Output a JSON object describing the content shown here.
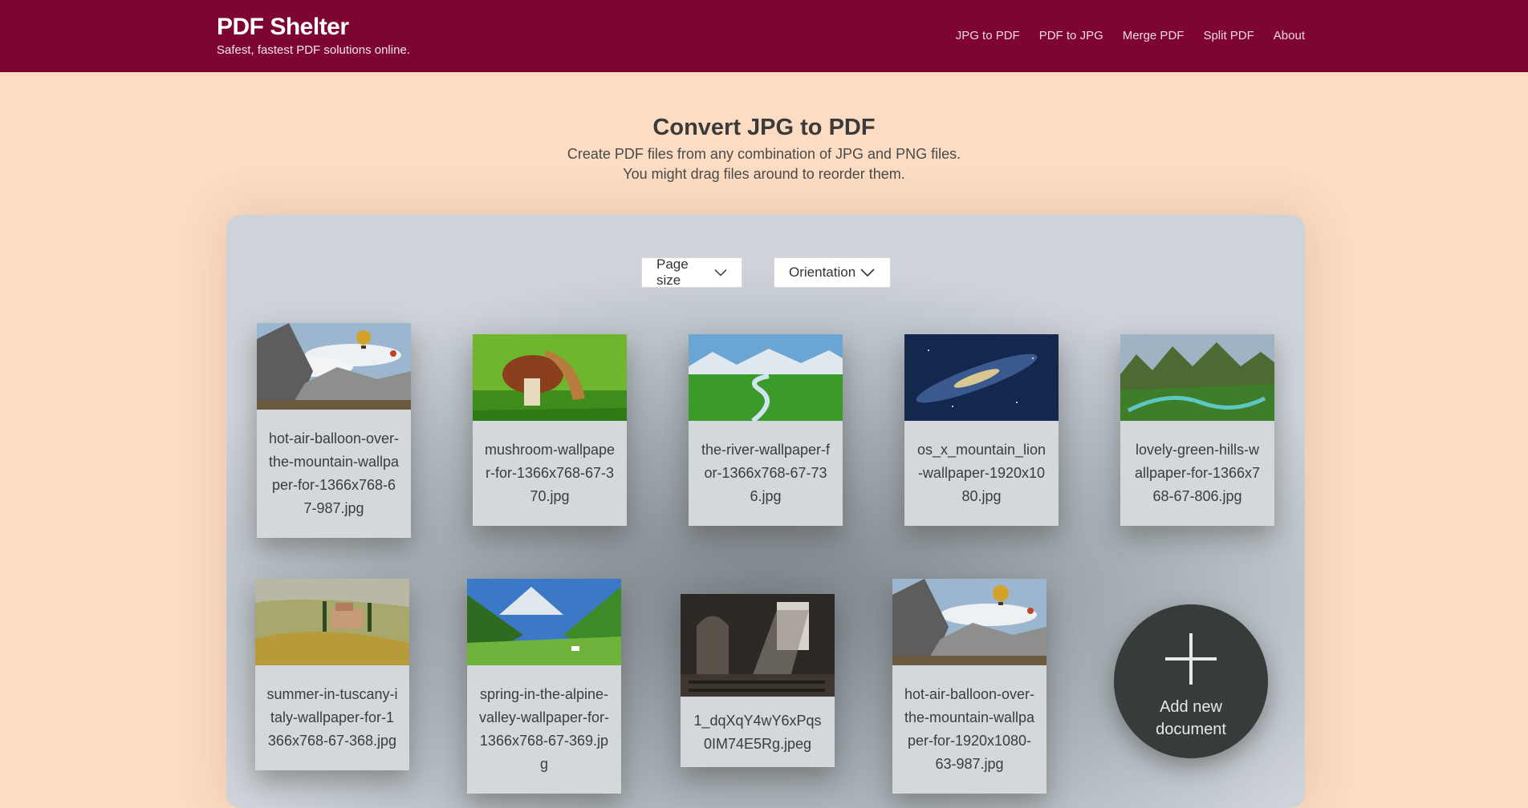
{
  "header": {
    "title": "PDF Shelter",
    "tagline": "Safest, fastest PDF solutions online.",
    "bg_color": "#7e0532",
    "nav": [
      "JPG to PDF",
      "PDF to JPG",
      "Merge PDF",
      "Split PDF",
      "About"
    ]
  },
  "intro": {
    "title": "Convert JPG to PDF",
    "line1": "Create PDF files from any combination of JPG and PNG files.",
    "line2": "You might drag files around to reorder them."
  },
  "controls": {
    "page_size_label": "Page size",
    "orientation_label": "Orientation"
  },
  "files": [
    {
      "name": "hot-air-balloon-over-the-mountain-wallpaper-for-1366x768-67-987.jpg",
      "scene": "balloon"
    },
    {
      "name": "mushroom-wallpaper-for-1366x768-67-370.jpg",
      "scene": "mushroom"
    },
    {
      "name": "the-river-wallpaper-for-1366x768-67-736.jpg",
      "scene": "river"
    },
    {
      "name": "os_x_mountain_lion-wallpaper-1920x1080.jpg",
      "scene": "galaxy"
    },
    {
      "name": "lovely-green-hills-wallpaper-for-1366x768-67-806.jpg",
      "scene": "hills"
    },
    {
      "name": "summer-in-tuscany-italy-wallpaper-for-1366x768-67-368.jpg",
      "scene": "tuscany"
    },
    {
      "name": "spring-in-the-alpine-valley-wallpaper-for-1366x768-67-369.jpg",
      "scene": "alpine"
    },
    {
      "name": "1_dqXqY4wY6xPqs0IM74E5Rg.jpeg",
      "scene": "church"
    },
    {
      "name": "hot-air-balloon-over-the-mountain-wallpaper-for-1920x1080-63-987.jpg",
      "scene": "balloon"
    }
  ],
  "add_button": {
    "label_line1": "Add new",
    "label_line2": "document"
  }
}
